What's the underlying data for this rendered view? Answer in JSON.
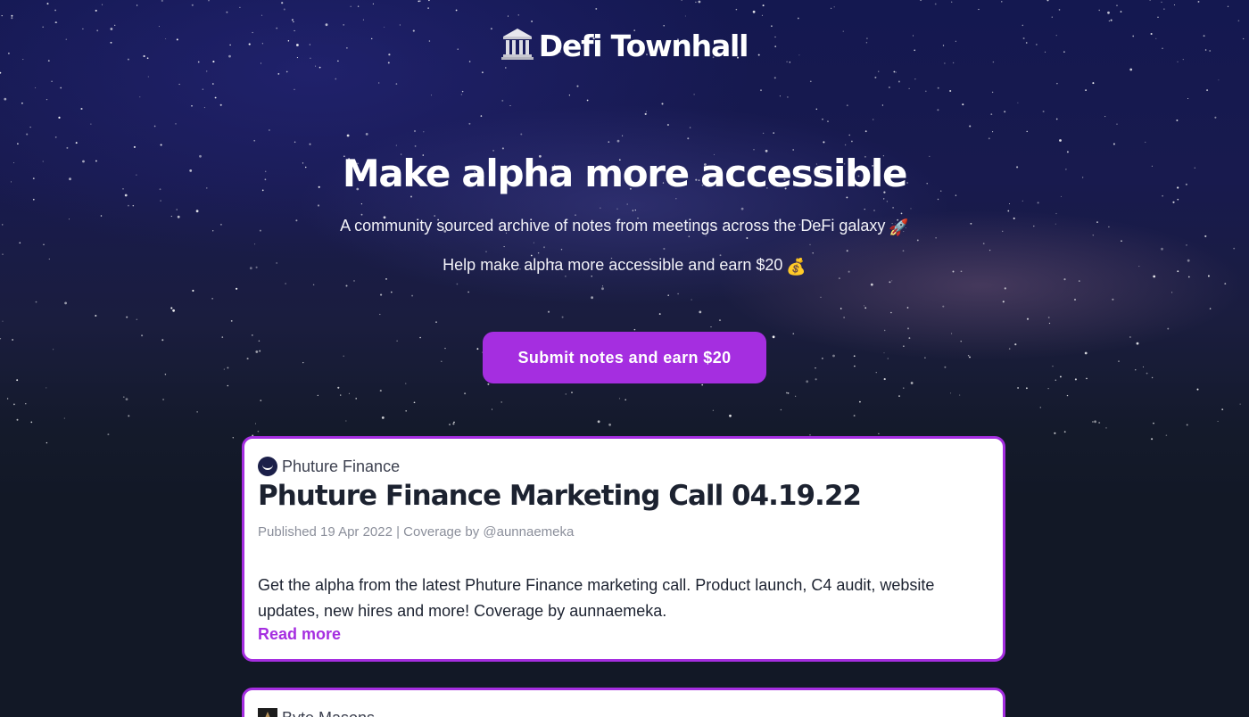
{
  "header": {
    "brand_name": "Defi Townhall"
  },
  "hero": {
    "title": "Make alpha more accessible",
    "subtitle_1": "A community sourced archive of notes from meetings across the DeFi galaxy",
    "subtitle_1_emoji": "🚀",
    "subtitle_2": "Help make alpha more accessible and earn $20",
    "subtitle_2_emoji": "💰",
    "cta_label": "Submit notes and earn $20"
  },
  "posts": [
    {
      "org": "Phuture Finance",
      "title": "Phuture Finance Marketing Call 04.19.22",
      "meta": "Published 19 Apr 2022 | Coverage by @aunnaemeka",
      "description": "Get the alpha from the latest Phuture Finance marketing call. Product launch, C4 audit, website updates, new hires and more! Coverage by aunnaemeka.",
      "read_more": "Read more"
    },
    {
      "org": "Byte Masons"
    }
  ],
  "colors": {
    "accent": "#a52ee0",
    "background": "#121826",
    "card_bg": "#ffffff",
    "title_text": "#1c2230",
    "meta_text": "#8b8f9b"
  },
  "icons": {
    "brand": "classical-building-icon",
    "rocket": "rocket-emoji",
    "money": "money-bag-emoji",
    "org_1": "phuture-logo-icon",
    "org_2": "byte-masons-logo-icon"
  }
}
